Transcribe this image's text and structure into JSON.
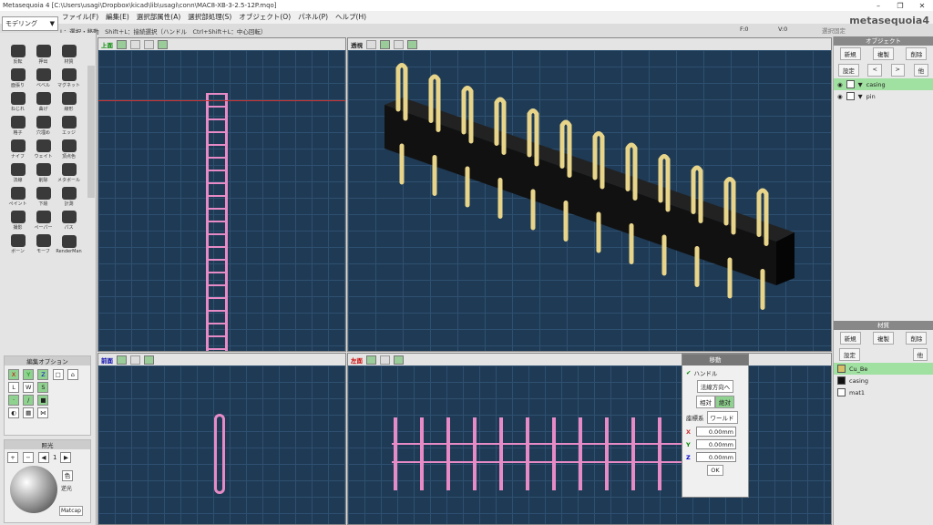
{
  "window": {
    "title": "Metasequoia 4 [C:\\Users\\usagi\\Dropbox\\kicad\\lib\\usagi\\conn\\MAC8-XB-3-2.5-12P.mqo]",
    "min": "–",
    "max": "❐",
    "close": "✕"
  },
  "mode": {
    "label": "モデリング"
  },
  "menu": [
    "ファイル(F)",
    "編集(E)",
    "選択部属性(A)",
    "選択部処理(S)",
    "オブジェクト(O)",
    "パネル(P)",
    "ヘルプ(H)"
  ],
  "logo": "metasequoia4",
  "status": "L：選択・移動　Shift＋L：接続選択（ハンドル　Ctrl+Shift＋L：中心回転）",
  "f": "F:0",
  "v": "V:0",
  "sel": "選択固定",
  "tools": [
    "反転",
    "押出",
    "材質",
    "面張り",
    "ベベル",
    "マグネット",
    "ねじれ",
    "曲げ",
    "線形",
    "格子",
    "穴埋め",
    "エッジ",
    "ナイフ",
    "ウェイト",
    "頂点色",
    "法線",
    "削除",
    "メタボール",
    "ペイント",
    "下絵",
    "計測",
    "撮影",
    "ペーパー",
    "パス",
    "ボーン",
    "モーフ",
    "RenderMan"
  ],
  "editopt": {
    "title": "編集オプション",
    "x": "X",
    "y": "Y",
    "z": "Z",
    "l": "L",
    "w": "W",
    "s": "S"
  },
  "light": {
    "title": "照光",
    "color": "色",
    "backlight": "逆光",
    "matcap": "Matcap",
    "val": "1"
  },
  "vp": {
    "top": "上面",
    "persp": "透視",
    "front": "前面",
    "left": "左面"
  },
  "objects": {
    "title": "オブジェクト",
    "new": "新規",
    "dup": "複製",
    "del": "削除",
    "set": "設定",
    "prev": "<",
    "next": ">",
    "opt": "他",
    "items": [
      "casing",
      "pin"
    ]
  },
  "materials": {
    "title": "材質",
    "new": "新規",
    "dup": "複製",
    "del": "削除",
    "set": "設定",
    "opt": "他",
    "items": [
      {
        "name": "Cu_Be",
        "color": "#d6c06a"
      },
      {
        "name": "casing",
        "color": "#111111"
      },
      {
        "name": "mat1",
        "color": "#ffffff"
      }
    ]
  },
  "move": {
    "title": "移動",
    "handle": "ハンドル",
    "normal": "法線方向へ",
    "rel": "相対",
    "abs": "絶対",
    "coord": "座標系",
    "world": "ワールド",
    "x": "X",
    "y": "Y",
    "z": "Z",
    "xv": "0.00mm",
    "yv": "0.00mm",
    "zv": "0.00mm",
    "ok": "OK"
  }
}
